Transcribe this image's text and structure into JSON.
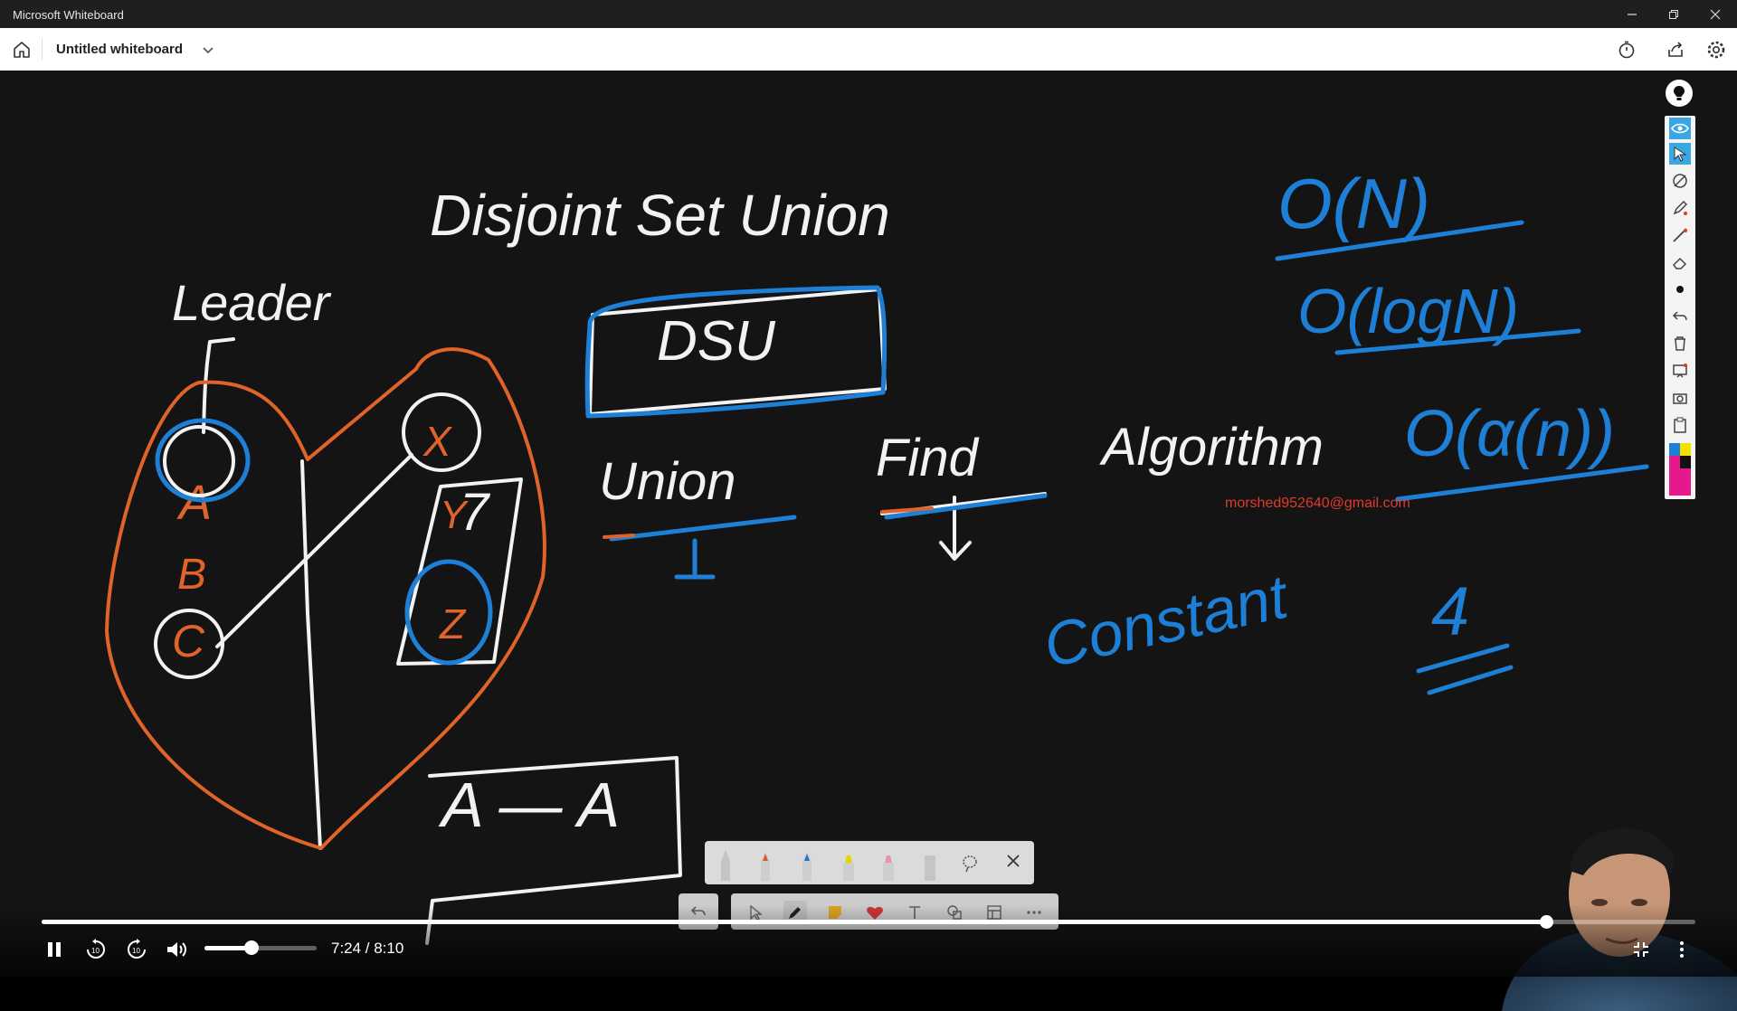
{
  "window": {
    "title": "Microsoft Whiteboard"
  },
  "header": {
    "doc_title": "Untitled whiteboard"
  },
  "board": {
    "handwriting": {
      "heading": "Disjoint Set Union",
      "leader_label": "Leader",
      "box_label": "DSU",
      "union_label": "Union",
      "find_label": "Find",
      "algorithm_label": "Algorithm",
      "constant_label": "Constant",
      "four_label": "4",
      "o_n": "O(N)",
      "o_logn": "O(logN)",
      "o_alpha": "O(α(n))",
      "node_a": "A",
      "node_b": "B",
      "node_c": "C",
      "node_x": "X",
      "node_y": "Y",
      "node_z": "Z",
      "seven": "7",
      "edge_text": "A — A"
    },
    "email_watermark": "morshed952640@gmail.com"
  },
  "colors": {
    "ink_white": "#f2f2f2",
    "ink_blue": "#1e7fd6",
    "ink_orange": "#e0632a",
    "board": "#141414"
  },
  "video": {
    "time": "7:24 / 8:10",
    "progress_fraction": 0.91,
    "volume_fraction": 0.42
  }
}
